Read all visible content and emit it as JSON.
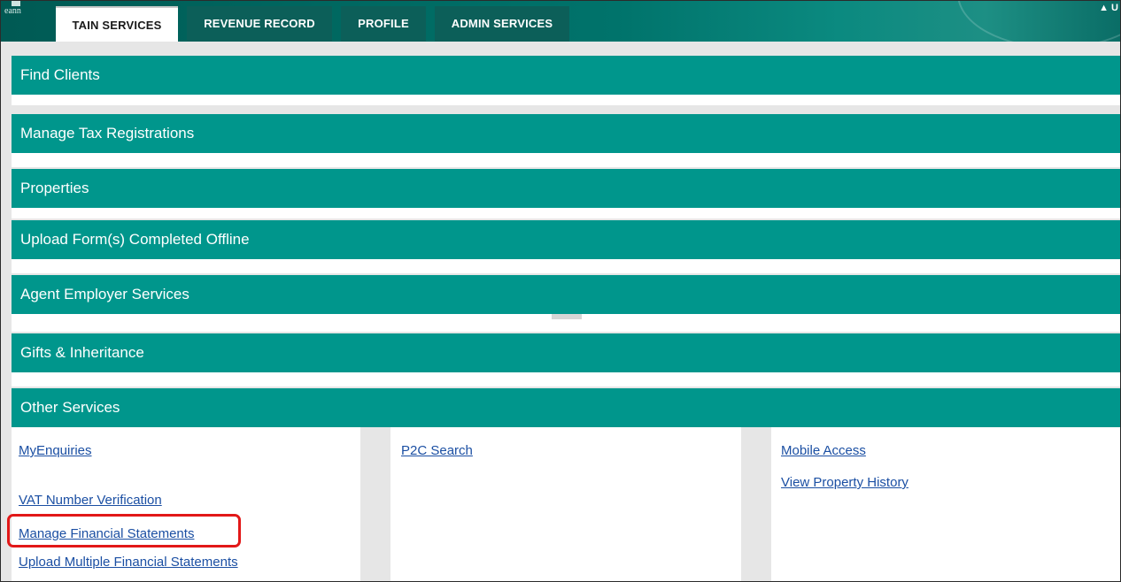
{
  "header": {
    "logo_text": "eann",
    "tabs": [
      {
        "label": "TAIN SERVICES",
        "active": true
      },
      {
        "label": "REVENUE RECORD",
        "active": false
      },
      {
        "label": "PROFILE",
        "active": false
      },
      {
        "label": "ADMIN SERVICES",
        "active": false
      }
    ],
    "user_indicator": "▲ U"
  },
  "sections": [
    {
      "label": "Find Clients"
    },
    {
      "label": "Manage Tax Registrations"
    },
    {
      "label": "Properties"
    },
    {
      "label": "Upload Form(s) Completed Offline"
    },
    {
      "label": "Agent Employer Services"
    },
    {
      "label": "Gifts & Inheritance"
    },
    {
      "label": "Other Services"
    }
  ],
  "other_services": {
    "column1": [
      "MyEnquiries",
      "VAT Number Verification",
      "Manage Financial Statements",
      "Upload Multiple Financial Statements"
    ],
    "column2": [
      "P2C Search"
    ],
    "column3": [
      "Mobile Access",
      "View Property History"
    ]
  },
  "colors": {
    "section_bar": "#00968c",
    "header_bg": "#00736b",
    "link": "#1b4fa3",
    "highlight": "#e21818"
  }
}
